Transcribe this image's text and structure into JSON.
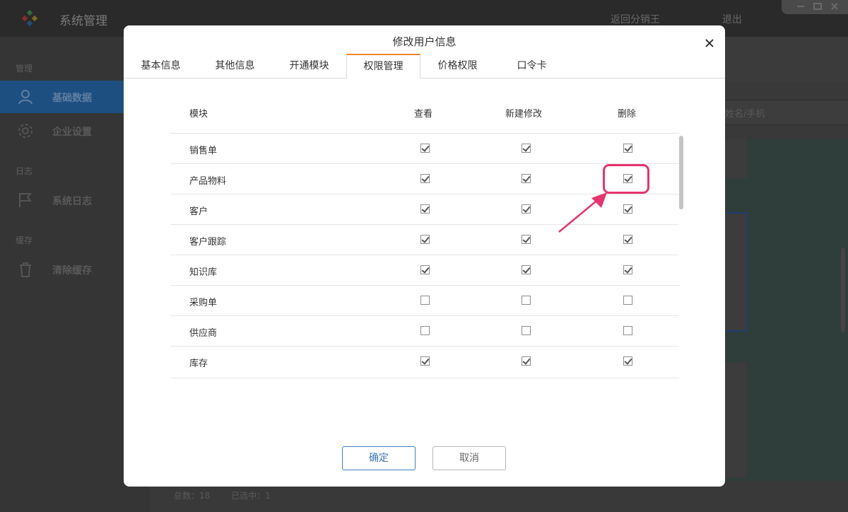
{
  "app": {
    "title": "系统管理",
    "return_link": "返回分销王",
    "exit_link": "退出"
  },
  "sidebar": {
    "groups": [
      {
        "label": "管理"
      },
      {
        "label": "日志"
      },
      {
        "label": "缓存"
      }
    ],
    "items": [
      {
        "label": "基础数据",
        "icon": "user-icon",
        "active": true
      },
      {
        "label": "企业设置",
        "icon": "gear-icon",
        "active": false
      },
      {
        "label": "系统日志",
        "icon": "flag-icon",
        "active": false
      },
      {
        "label": "清除缓存",
        "icon": "trash-icon",
        "active": false
      }
    ]
  },
  "background": {
    "search_placeholder": "姓名/手机",
    "footer": {
      "total": "总数：18",
      "selected": "已选中：1"
    }
  },
  "modal": {
    "title": "修改用户信息",
    "tabs": [
      {
        "label": "基本信息",
        "active": false
      },
      {
        "label": "其他信息",
        "active": false
      },
      {
        "label": "开通模块",
        "active": false
      },
      {
        "label": "权限管理",
        "active": true
      },
      {
        "label": "价格权限",
        "active": false
      },
      {
        "label": "口令卡",
        "active": false
      }
    ],
    "table": {
      "headers": {
        "module": "模块",
        "view": "查看",
        "edit": "新建修改",
        "delete": "删除"
      },
      "rows": [
        {
          "module": "销售单",
          "view": true,
          "edit": true,
          "delete": true
        },
        {
          "module": "产品物料",
          "view": true,
          "edit": true,
          "delete": true
        },
        {
          "module": "客户",
          "view": true,
          "edit": true,
          "delete": true
        },
        {
          "module": "客户跟踪",
          "view": true,
          "edit": true,
          "delete": true
        },
        {
          "module": "知识库",
          "view": true,
          "edit": true,
          "delete": true
        },
        {
          "module": "采购单",
          "view": false,
          "edit": false,
          "delete": false
        },
        {
          "module": "供应商",
          "view": false,
          "edit": false,
          "delete": false
        },
        {
          "module": "库存",
          "view": true,
          "edit": true,
          "delete": true
        }
      ]
    },
    "buttons": {
      "ok": "确定",
      "cancel": "取消"
    },
    "annotation_color": "#e8336d",
    "accent_tab_color": "#f0882e"
  }
}
